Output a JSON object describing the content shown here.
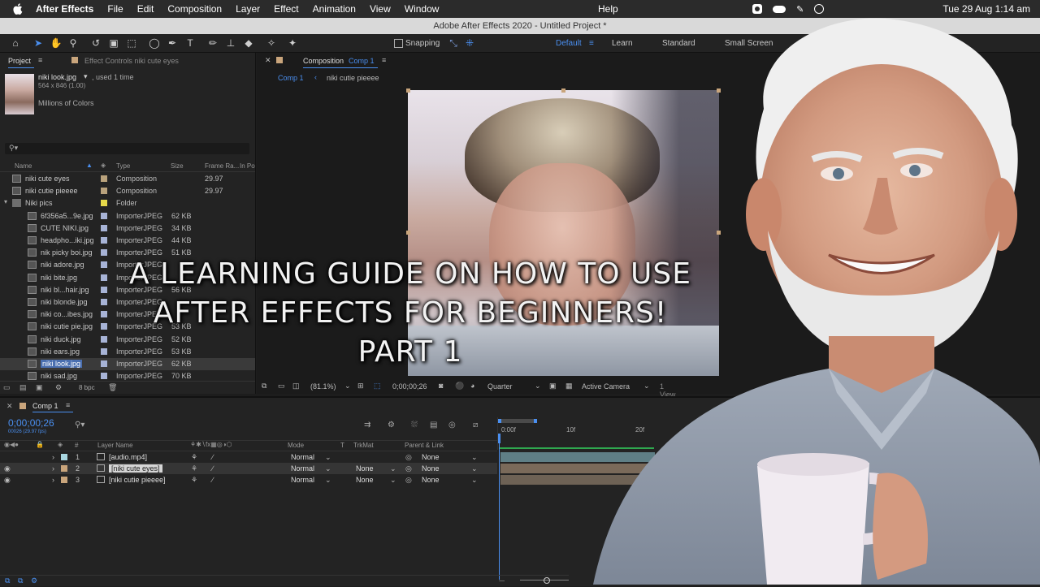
{
  "menubar": {
    "app": "After Effects",
    "items": [
      "File",
      "Edit",
      "Composition",
      "Layer",
      "Effect",
      "Animation",
      "View",
      "Window"
    ],
    "help": "Help",
    "clock": "Tue 29 Aug  1:14 am"
  },
  "window_title": "Adobe After Effects 2020 - Untitled Project *",
  "toolbar": {
    "snapping": "Snapping",
    "workspaces": [
      "Default",
      "Learn",
      "Standard",
      "Small Screen"
    ]
  },
  "project": {
    "tab": "Project",
    "effect_controls_tab": "Effect Controls niki cute eyes",
    "preview_name": "niki look.jpg",
    "preview_used": ", used 1 time",
    "preview_dims": "564 x 846 (1.00)",
    "preview_colors": "Millions of Colors",
    "columns": {
      "name": "Name",
      "type": "Type",
      "size": "Size",
      "frame_rate": "Frame Ra...",
      "in_point": "In Po"
    },
    "items": [
      {
        "name": "niki cute eyes",
        "type": "Composition",
        "size": "",
        "rate": "29.97",
        "kind": "comp",
        "color": "#b9a27c",
        "indent": 0
      },
      {
        "name": "niki cutie pieeee",
        "type": "Composition",
        "size": "",
        "rate": "29.97",
        "kind": "comp",
        "color": "#b9a27c",
        "indent": 0
      },
      {
        "name": "Niki pics",
        "type": "Folder",
        "size": "",
        "rate": "",
        "kind": "folder",
        "color": "#e6d84a",
        "indent": 0
      },
      {
        "name": "6f356a5...9e.jpg",
        "type": "ImporterJPEG",
        "size": "62 KB",
        "rate": "",
        "kind": "file",
        "color": "#a7b3d6",
        "indent": 1
      },
      {
        "name": "CUTE NIKI.jpg",
        "type": "ImporterJPEG",
        "size": "34 KB",
        "rate": "",
        "kind": "file",
        "color": "#a7b3d6",
        "indent": 1
      },
      {
        "name": "headpho...iki.jpg",
        "type": "ImporterJPEG",
        "size": "44 KB",
        "rate": "",
        "kind": "file",
        "color": "#a7b3d6",
        "indent": 1
      },
      {
        "name": "nik picky boi.jpg",
        "type": "ImporterJPEG",
        "size": "51 KB",
        "rate": "",
        "kind": "file",
        "color": "#a7b3d6",
        "indent": 1
      },
      {
        "name": "niki adore.jpg",
        "type": "ImporterJPEG",
        "size": "",
        "rate": "",
        "kind": "file",
        "color": "#a7b3d6",
        "indent": 1
      },
      {
        "name": "niki bite.jpg",
        "type": "ImporterJPEG",
        "size": "",
        "rate": "",
        "kind": "file",
        "color": "#a7b3d6",
        "indent": 1
      },
      {
        "name": "niki bl...hair.jpg",
        "type": "ImporterJPEG",
        "size": "56 KB",
        "rate": "",
        "kind": "file",
        "color": "#a7b3d6",
        "indent": 1
      },
      {
        "name": "niki blonde.jpg",
        "type": "ImporterJPEG",
        "size": "",
        "rate": "",
        "kind": "file",
        "color": "#a7b3d6",
        "indent": 1
      },
      {
        "name": "niki co...ibes.jpg",
        "type": "ImporterJPEG",
        "size": "",
        "rate": "",
        "kind": "file",
        "color": "#a7b3d6",
        "indent": 1
      },
      {
        "name": "niki cutie pie.jpg",
        "type": "ImporterJPEG",
        "size": "53 KB",
        "rate": "",
        "kind": "file",
        "color": "#a7b3d6",
        "indent": 1
      },
      {
        "name": "niki duck.jpg",
        "type": "ImporterJPEG",
        "size": "52 KB",
        "rate": "",
        "kind": "file",
        "color": "#a7b3d6",
        "indent": 1
      },
      {
        "name": "niki ears.jpg",
        "type": "ImporterJPEG",
        "size": "53 KB",
        "rate": "",
        "kind": "file",
        "color": "#a7b3d6",
        "indent": 1
      },
      {
        "name": "niki look.jpg",
        "type": "ImporterJPEG",
        "size": "62 KB",
        "rate": "",
        "kind": "file",
        "color": "#a7b3d6",
        "indent": 1,
        "selected": true
      },
      {
        "name": "niki sad.jpg",
        "type": "ImporterJPEG",
        "size": "70 KB",
        "rate": "",
        "kind": "file",
        "color": "#a7b3d6",
        "indent": 1
      }
    ],
    "bpc": "8 bpc"
  },
  "composition": {
    "tab_prefix": "Composition",
    "tab_comp": "Comp 1",
    "breadcrumb_1": "Comp 1",
    "breadcrumb_2": "niki cutie pieeee",
    "zoom": "(81.1%)",
    "timecode": "0;00;00;26",
    "resolution": "Quarter",
    "camera": "Active Camera",
    "views": "1 View"
  },
  "headline": {
    "line1": "A LEARNING GUIDE ON HOW TO USE",
    "line2": "AFTER EFFECTS FOR BEGINNERS!",
    "line3": "PART 1"
  },
  "timeline": {
    "tab": "Comp 1",
    "timecode": "0;00;00;26",
    "timecode_sub": "00026 (29.97 fps)",
    "col_layer_name": "Layer Name",
    "col_mode": "Mode",
    "col_t": "T",
    "col_trkmat": "TrkMat",
    "col_parent": "Parent & Link",
    "ruler": [
      "0:00f",
      "10f",
      "20f"
    ],
    "layers": [
      {
        "num": "1",
        "name": "[audio.mp4]",
        "mode": "Normal",
        "trkmat": "",
        "parent": "None",
        "color": "#a9d6e0"
      },
      {
        "num": "2",
        "name": "[niki cute eyes]",
        "mode": "Normal",
        "trkmat": "None",
        "parent": "None",
        "color": "#c9a57c",
        "selected": true
      },
      {
        "num": "3",
        "name": "[niki cutie pieeee]",
        "mode": "Normal",
        "trkmat": "None",
        "parent": "None",
        "color": "#c9a57c"
      }
    ]
  }
}
